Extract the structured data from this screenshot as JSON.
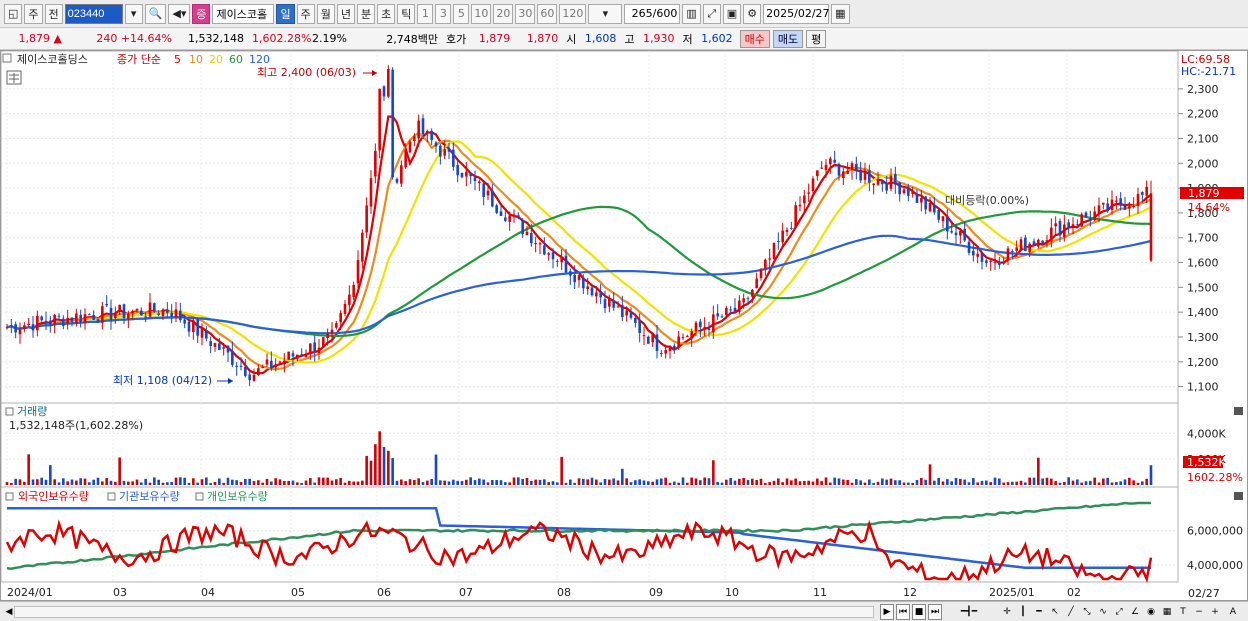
{
  "toolbar": {
    "type_label": "주",
    "prev_label": "전",
    "code": "023440",
    "name_tag": "증",
    "name": "제이스코홀",
    "periods": [
      "일",
      "주",
      "월",
      "년",
      "분",
      "초",
      "틱"
    ],
    "active_period": "일",
    "nums": [
      "1",
      "3",
      "5",
      "10",
      "20",
      "30",
      "60",
      "120"
    ],
    "count": "265",
    "count_total": "/600",
    "date": "2025/02/27"
  },
  "quote": {
    "price": "1,879 ▲",
    "change": "240 +14.64%",
    "volume": "1,532,148",
    "volume_pct": "1,602.28%",
    "turnover": "2.19%",
    "amount": "2,748백만",
    "ask_label": "호가",
    "ask": "1,879",
    "bid": "1,870",
    "open_label": "시",
    "open": "1,608",
    "high_label": "고",
    "high": "1,930",
    "low_label": "저",
    "low": "1,602",
    "buy_label": "매수",
    "sell_label": "매도",
    "eval_label": "평"
  },
  "price_panel": {
    "stock_label": "제이스코홀딩스",
    "legend_prefix": "종가 단순",
    "ma_items": [
      {
        "label": "5",
        "color": "#e00000"
      },
      {
        "label": "10",
        "color": "#f08a1a"
      },
      {
        "label": "20",
        "color": "#f2e200"
      },
      {
        "label": "60",
        "color": "#1e9a38"
      },
      {
        "label": "120",
        "color": "#2a60d8"
      }
    ],
    "lc": "LC:69.58",
    "hc": "HC:-21.71",
    "high_note": "최고 2,400 (06/03)",
    "low_note": "최저 1,108 (04/12)",
    "flat_note": "대비등락(0.00%)",
    "current_price_tag": "1,879",
    "current_pct_tag": "14.64%",
    "y_ticks": [
      "2,300",
      "2,200",
      "2,100",
      "2,000",
      "1,900",
      "1,800",
      "1,700",
      "1,600",
      "1,500",
      "1,400",
      "1,300",
      "1,200",
      "1,100"
    ]
  },
  "volume_panel": {
    "title": "거래량",
    "value": "1,532,148주(1,602.28%)",
    "y_ticks": [
      "4,000K",
      "2,000K"
    ],
    "current_tag": "1,532K",
    "current_pct": "1602.28%"
  },
  "holding_panel": {
    "legend": [
      {
        "label": "외국인보유수량",
        "color": "#e00000"
      },
      {
        "label": "기관보유수량",
        "color": "#2a60d8"
      },
      {
        "label": "개인보유수량",
        "color": "#1e9a58"
      }
    ],
    "y_ticks": [
      "6,000,000",
      "4,000,000"
    ]
  },
  "x_axis": {
    "labels": [
      "2024/01",
      "03",
      "04",
      "05",
      "06",
      "07",
      "08",
      "09",
      "10",
      "11",
      "12",
      "2025/01",
      "02"
    ],
    "right_label": "02/27"
  },
  "chart_data": {
    "type": "candlestick",
    "x_range": [
      "2024/01",
      "2025/02/27"
    ],
    "y_range": [
      1050,
      2380
    ],
    "price_anchors": [
      [
        "2024/01",
        1340
      ],
      [
        "2024/02",
        1390
      ],
      [
        "2024/03",
        1410
      ],
      [
        "2024/04",
        1150
      ],
      [
        "2024/05",
        1300
      ],
      [
        "2024/06",
        2150
      ],
      [
        "2024/07",
        1830
      ],
      [
        "2024/08",
        1540
      ],
      [
        "2024/09",
        1260
      ],
      [
        "2024/10",
        1420
      ],
      [
        "2024/11",
        2000
      ],
      [
        "2024/12",
        1900
      ],
      [
        "2025/01",
        1600
      ],
      [
        "2025/02",
        1760
      ],
      [
        "2025/02/27",
        1879
      ]
    ],
    "markers": {
      "high": {
        "date": "06/03",
        "value": 2400
      },
      "low": {
        "date": "04/12",
        "value": 1108
      }
    },
    "last": {
      "open": 1608,
      "high": 1930,
      "low": 1602,
      "close": 1879
    },
    "moving_averages": [
      5,
      10,
      20,
      60,
      120
    ],
    "volume_peak_k": 4800,
    "volume_last_k": 1532,
    "holdings": {
      "foreign": "red",
      "institution": "blue",
      "individual": "green"
    }
  }
}
